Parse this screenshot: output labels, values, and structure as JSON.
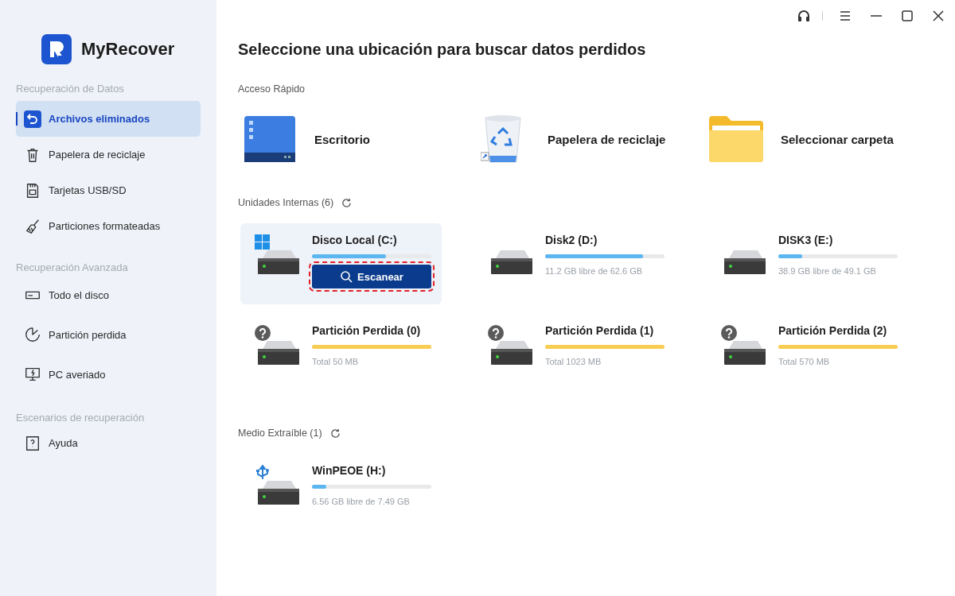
{
  "app": {
    "name": "MyRecover"
  },
  "sidebar": {
    "sections": [
      {
        "header": "Recuperación de Datos",
        "items": [
          {
            "label": "Archivos eliminados",
            "selected": true
          },
          {
            "label": "Papelera de reciclaje",
            "selected": false
          },
          {
            "label": "Tarjetas USB/SD",
            "selected": false
          },
          {
            "label": "Particiones formateadas",
            "selected": false
          }
        ]
      },
      {
        "header": "Recuperación Avanzada",
        "items": [
          {
            "label": "Todo el disco",
            "selected": false
          },
          {
            "label": "Partición perdida",
            "selected": false
          },
          {
            "label": "PC averiado",
            "selected": false
          }
        ]
      },
      {
        "header": "Escenarios de recuperación",
        "items": [
          {
            "label": "Ayuda",
            "selected": false
          }
        ]
      }
    ]
  },
  "title": "Seleccione una ubicación para buscar datos perdidos",
  "quick_access": {
    "header": "Acceso Rápido",
    "items": [
      {
        "kind": "desktop",
        "label": "Escritorio"
      },
      {
        "kind": "recycle",
        "label": "Papelera de reciclaje"
      },
      {
        "kind": "folder",
        "label": "Seleccionar carpeta"
      }
    ]
  },
  "internal_drives": {
    "header": "Unidades Internas (6)",
    "drives": [
      {
        "kind": "system",
        "name": "Disco Local (C:)",
        "level": 0.62,
        "selected": true,
        "button": "Escanear"
      },
      {
        "kind": "disk",
        "name": "Disk2 (D:)",
        "level": 0.82,
        "selected": false,
        "info": "11.2 GB libre de 62.6 GB"
      },
      {
        "kind": "disk",
        "name": "DISK3 (E:)",
        "level": 0.2,
        "selected": false,
        "info": "38.9 GB libre de 49.1 GB"
      },
      {
        "kind": "lost",
        "name": "Partición Perdida (0)",
        "level": 1,
        "selected": false,
        "info": "Total 50 MB"
      },
      {
        "kind": "lost",
        "name": "Partición Perdida (1)",
        "level": 1,
        "selected": false,
        "info": "Total 1023 MB"
      },
      {
        "kind": "lost",
        "name": "Partición Perdida (2)",
        "level": 1,
        "selected": false,
        "info": "Total 570 MB"
      }
    ]
  },
  "removable_drives": {
    "header": "Medio Extraíble (1)",
    "drives": [
      {
        "kind": "usb",
        "name": "WinPEOE (H:)",
        "level": 0.12,
        "selected": false,
        "info": "6.56 GB libre de 7.49 GB"
      }
    ]
  }
}
